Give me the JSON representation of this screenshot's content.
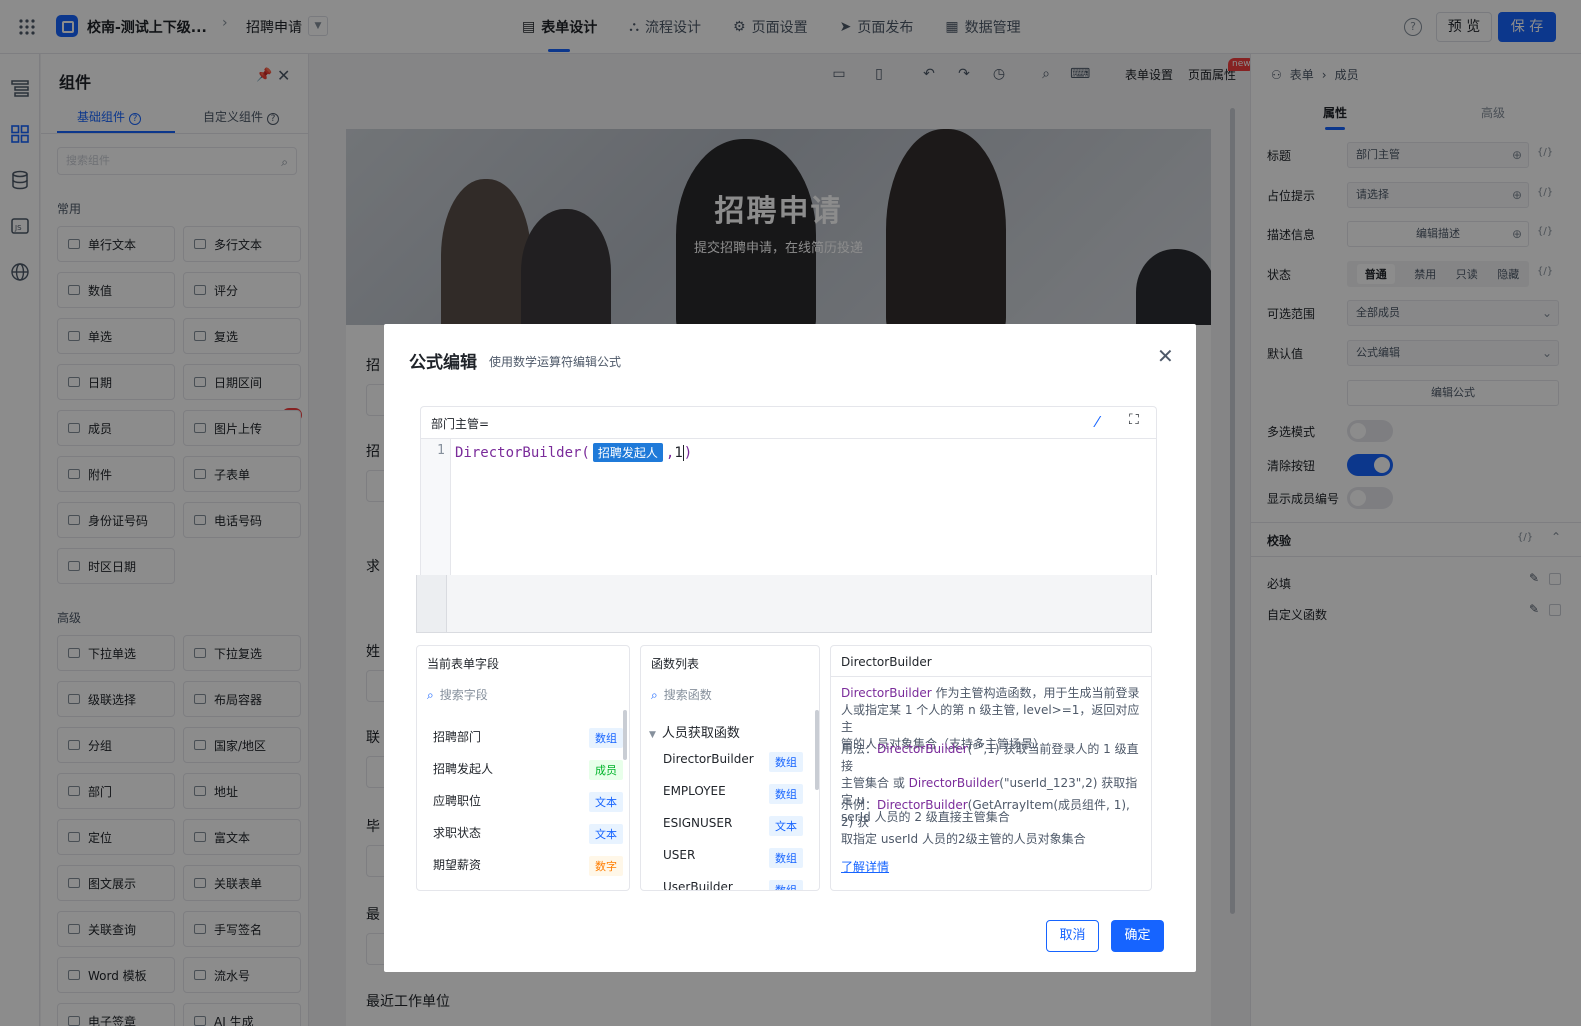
{
  "app": {
    "name": "校南-测试上下级...",
    "form_name": "招聘申请"
  },
  "nav": {
    "tabs": [
      {
        "label": "表单设计",
        "icon": "form-icon"
      },
      {
        "label": "流程设计",
        "icon": "flow-icon"
      },
      {
        "label": "页面设置",
        "icon": "gear-icon"
      },
      {
        "label": "页面发布",
        "icon": "send-icon"
      },
      {
        "label": "数据管理",
        "icon": "table-icon"
      }
    ],
    "preview": "预 览",
    "save": "保 存",
    "help": "?"
  },
  "components": {
    "title": "组件",
    "tab_basic": "基础组件",
    "tab_custom": "自定义组件",
    "search_placeholder": "搜索组件",
    "section_common": "常用",
    "section_advanced": "高级",
    "common": [
      "单行文本",
      "多行文本",
      "数值",
      "评分",
      "单选",
      "复选",
      "日期",
      "日期区间",
      "成员",
      "图片上传",
      "附件",
      "子表单",
      "身份证号码",
      "电话号码",
      "时区日期"
    ],
    "advanced": [
      "下拉单选",
      "下拉复选",
      "级联选择",
      "布局容器",
      "分组",
      "国家/地区",
      "部门",
      "地址",
      "定位",
      "富文本",
      "图文展示",
      "关联表单",
      "关联查询",
      "手写签名",
      "Word 模板",
      "流水号",
      "电子签章",
      "AI 生成"
    ],
    "ai_badge": "AI"
  },
  "canvas": {
    "toolbar_form_settings": "表单设置",
    "toolbar_page_props": "页面属性",
    "new_badge": "new",
    "banner_title": "招聘申请",
    "banner_subtitle": "提交招聘申请，在线简历投递",
    "field_labels": [
      "招",
      "招",
      "求",
      "姓",
      "联",
      "毕",
      "最",
      "最近工作单位"
    ]
  },
  "properties": {
    "crumb": [
      "表单",
      "成员"
    ],
    "tab_props": "属性",
    "tab_advanced": "高级",
    "rows": {
      "title_label": "标题",
      "title_value": "部门主管",
      "placeholder_label": "占位提示",
      "placeholder_value": "请选择",
      "desc_label": "描述信息",
      "desc_button": "编辑描述",
      "status_label": "状态",
      "status_options": [
        "普通",
        "禁用",
        "只读",
        "隐藏"
      ],
      "range_label": "可选范围",
      "range_value": "全部成员",
      "default_label": "默认值",
      "default_value": "公式编辑",
      "edit_formula": "编辑公式",
      "multi_label": "多选模式",
      "clear_label": "清除按钮",
      "show_id_label": "显示成员编号",
      "validate_label": "校验",
      "required_label": "必填",
      "custom_fn_label": "自定义函数",
      "expr_icon": "{/}"
    }
  },
  "dialog": {
    "title": "公式编辑",
    "subtitle": "使用数学运算符编辑公式",
    "editor_label": "部门主管=",
    "line_number": "1",
    "code_fn": "DirectorBuilder(",
    "code_field": "招聘发起人",
    "code_comma": ",",
    "code_arg": "1",
    "code_close": ")",
    "fields_panel": {
      "title": "当前表单字段",
      "search_placeholder": "搜索字段",
      "items": [
        {
          "name": "招聘部门",
          "type": "数组",
          "color": "blue"
        },
        {
          "name": "招聘发起人",
          "type": "成员",
          "color": "green"
        },
        {
          "name": "应聘职位",
          "type": "文本",
          "color": "blue"
        },
        {
          "name": "求职状态",
          "type": "文本",
          "color": "blue"
        },
        {
          "name": "期望薪资",
          "type": "数字",
          "color": "orange"
        }
      ]
    },
    "functions_panel": {
      "title": "函数列表",
      "search_placeholder": "搜索函数",
      "group": "人员获取函数",
      "items": [
        {
          "name": "DirectorBuilder",
          "type": "数组"
        },
        {
          "name": "EMPLOYEE",
          "type": "数组"
        },
        {
          "name": "ESIGNUSER",
          "type": "文本"
        },
        {
          "name": "USER",
          "type": "数组"
        },
        {
          "name": "UserBuilder",
          "type": "数组"
        }
      ]
    },
    "doc_panel": {
      "title": "DirectorBuilder",
      "desc_fn": "DirectorBuilder",
      "desc_1": " 作为主管构造函数，用于生成当前登录",
      "desc_2": "人或指定某 1 个人的第 n 级主管,",
      "desc_3": " level>=1，返回对应主",
      "desc_4": "管的人员对象集合（支持多主管场景）",
      "usage_prefix": "用法：",
      "usage_fn1": "DirectorBuilder",
      "usage_1": "(\"\",1) 获取当前登录人的 1 级直接",
      "usage_2a": "主管集合 或 ",
      "usage_fn2": "DirectorBuilder",
      "usage_2b": "(\"userId_123\",2) 获取指定 u",
      "usage_3": "serId 人员的 2 级直接主管集合",
      "example_prefix": "示例：",
      "example_fn": "DirectorBuilder",
      "example_1": "(GetArrayItem(成员组件, 1), 2) 获",
      "example_2": "取指定 userId 人员的2级主管的人员对象集合",
      "learn_more": "了解详情"
    },
    "cancel": "取消",
    "confirm": "确定"
  }
}
